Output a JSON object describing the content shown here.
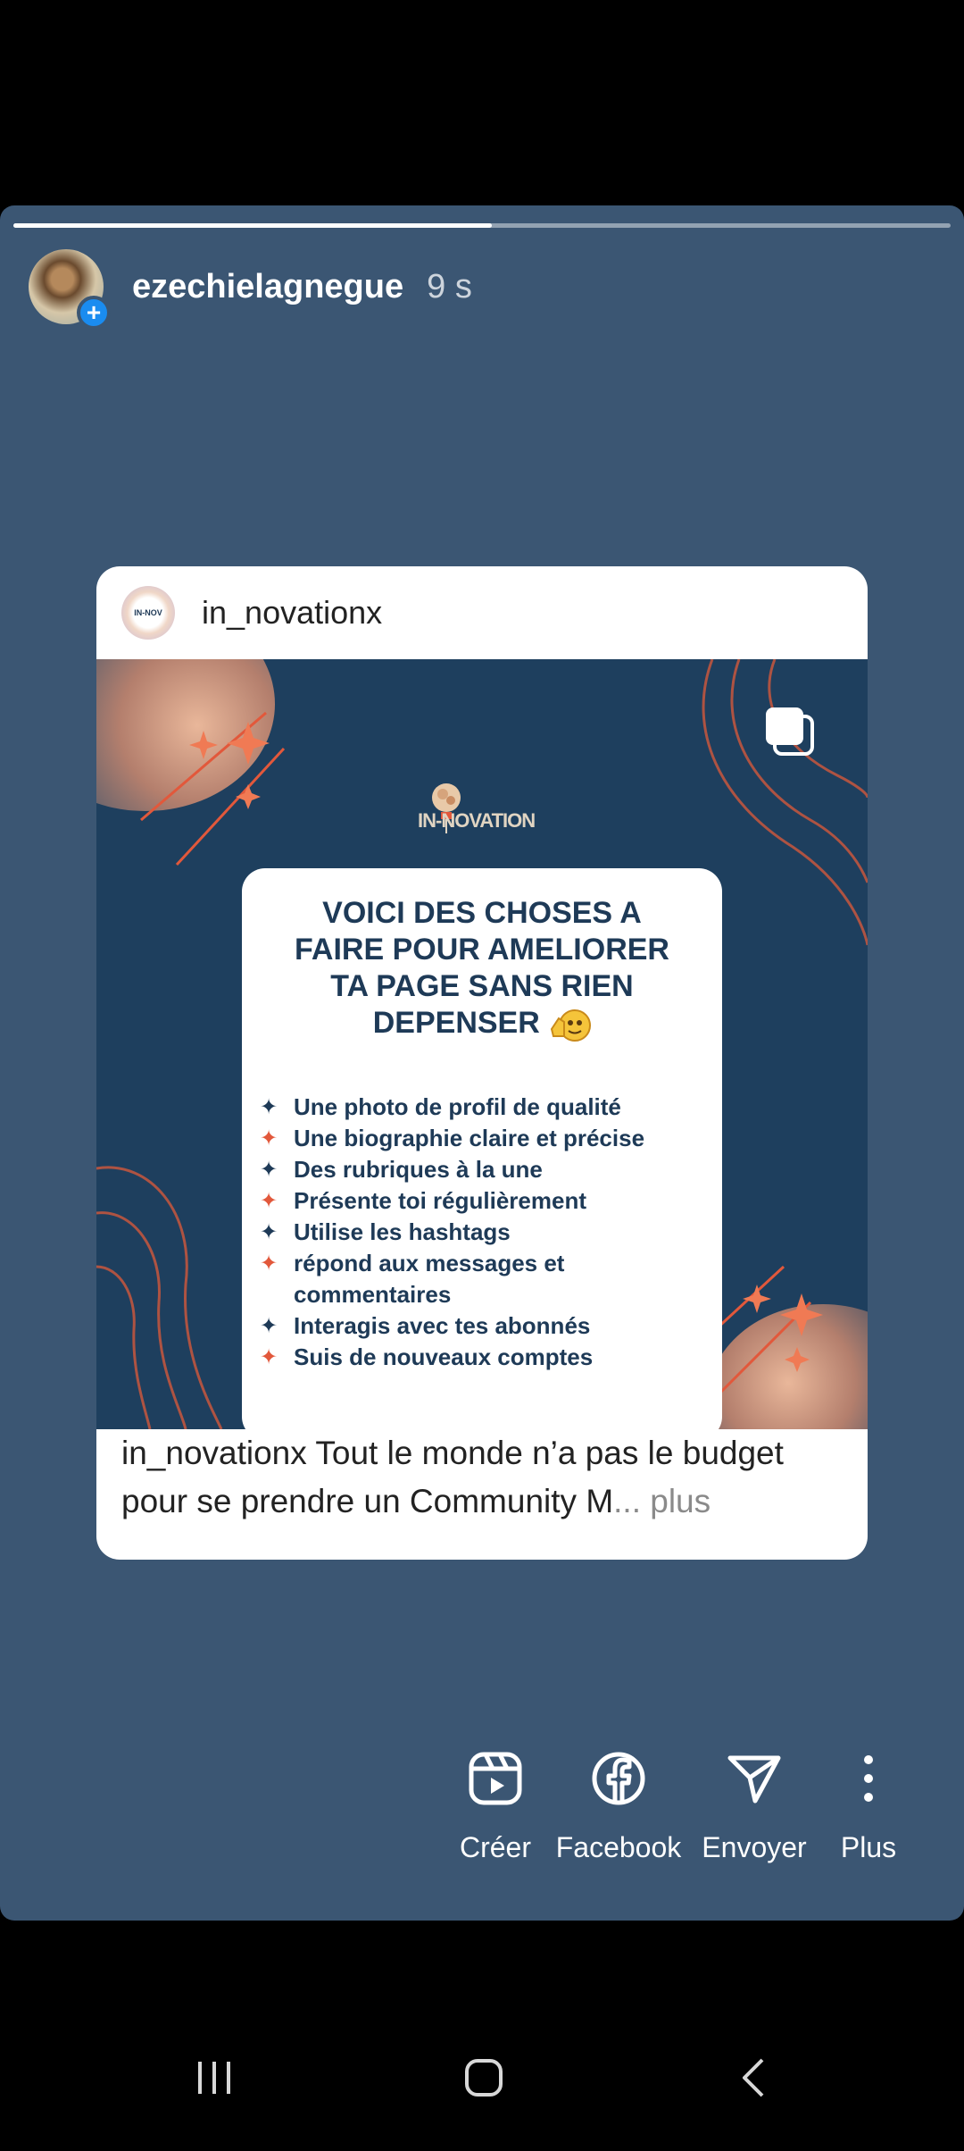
{
  "story": {
    "username": "ezechielagnegue",
    "time_ago": "9 s",
    "progress": 0.51
  },
  "post": {
    "username": "in_novationx",
    "logo_text": "IN-NOVATION",
    "title_lines": [
      "VOICI DES CHOSES A",
      "FAIRE POUR AMELIORER",
      "TA PAGE SANS RIEN",
      "DEPENSER"
    ],
    "tips": [
      {
        "text": "Une photo de profil de qualité",
        "color": "#1e3a57"
      },
      {
        "text": "Une biographie claire et précise",
        "color": "#e2583b"
      },
      {
        "text": "Des rubriques à la une",
        "color": "#1e3a57"
      },
      {
        "text": "Présente toi régulièrement",
        "color": "#e2583b"
      },
      {
        "text": "Utilise les hashtags",
        "color": "#1e3a57"
      },
      {
        "text": "répond aux messages et commentaires",
        "color": "#e2583b"
      },
      {
        "text": "Interagis avec tes abonnés",
        "color": "#1e3a57"
      },
      {
        "text": "Suis de nouveaux comptes",
        "color": "#e2583b"
      }
    ],
    "caption": "in_novationx Tout le monde n’a pas le budget pour se prendre un Community  M",
    "caption_more": "... plus"
  },
  "actions": {
    "create": "Créer",
    "facebook": "Facebook",
    "send": "Envoyer",
    "more": "Plus"
  },
  "colors": {
    "story_bg": "#3b5673",
    "post_bg": "#1e3f5e",
    "accent_orange": "#e2583b",
    "navy": "#1e3a57"
  }
}
